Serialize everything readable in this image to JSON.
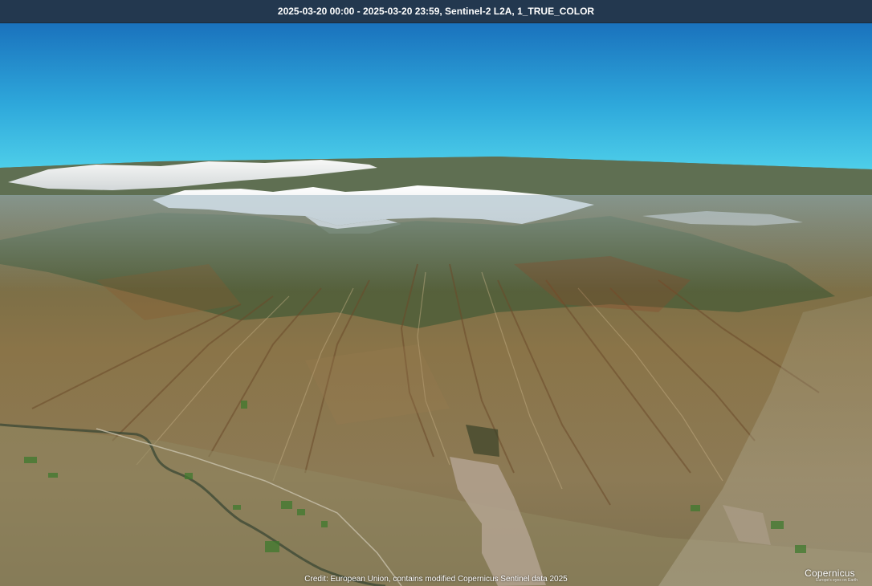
{
  "header": {
    "title": "2025-03-20 00:00 - 2025-03-20 23:59, Sentinel-2 L2A, 1_TRUE_COLOR"
  },
  "footer": {
    "credit": "Credit: European Union, contains modified Copernicus Sentinel data 2025"
  },
  "logo": {
    "text": "Copernicus",
    "tagline": "Europe's eyes on Earth"
  },
  "colors": {
    "header_bg": "#23384f",
    "sky_top": "#1a72bd",
    "sky_horizon": "#4fd0ea",
    "snow": "#f4f4f2"
  }
}
